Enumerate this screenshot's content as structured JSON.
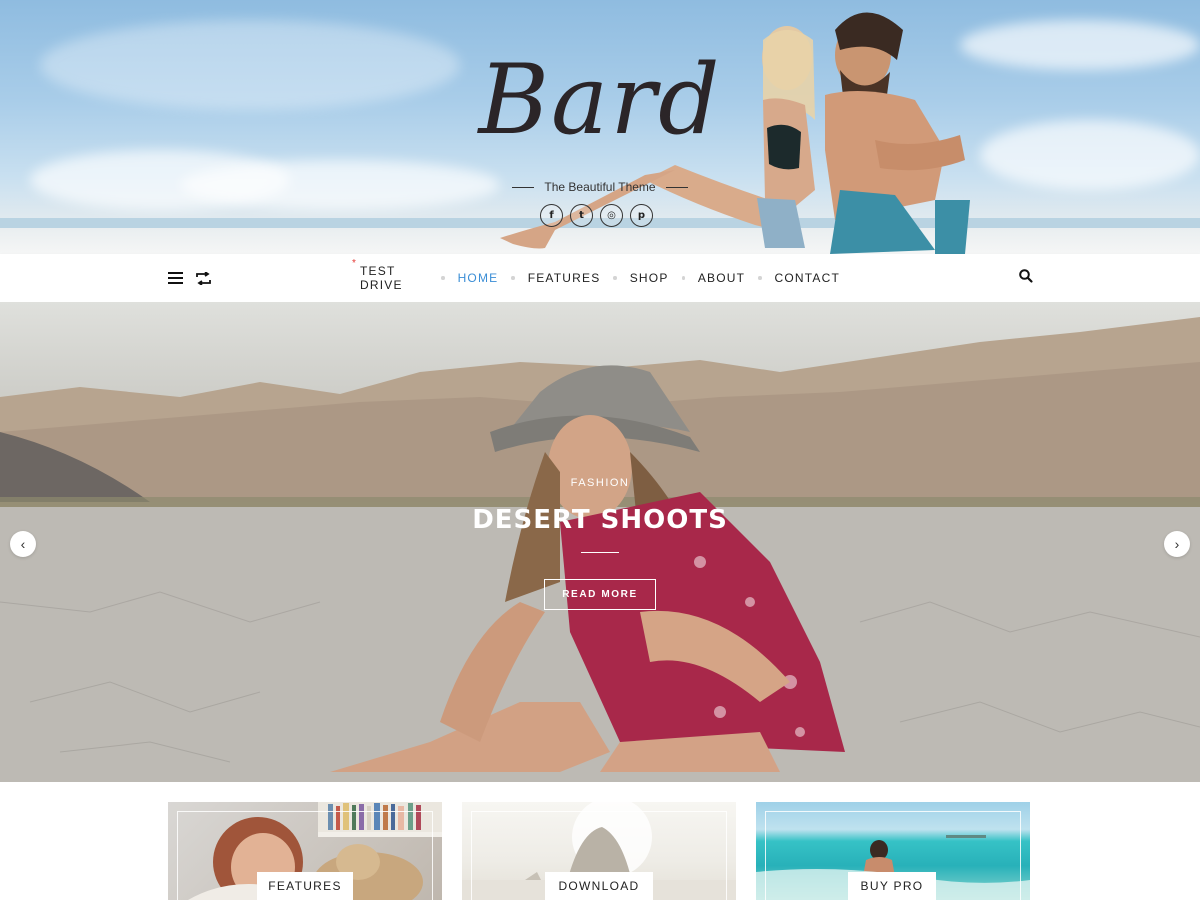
{
  "header": {
    "logo": "Bard",
    "tagline": "The Beautiful Theme",
    "social": [
      {
        "icon": "facebook-icon",
        "glyph": "f"
      },
      {
        "icon": "twitter-icon",
        "glyph": "t"
      },
      {
        "icon": "instagram-icon",
        "glyph": "◎"
      },
      {
        "icon": "pinterest-icon",
        "glyph": "p"
      }
    ]
  },
  "nav": {
    "items": [
      {
        "label": "TEST DRIVE",
        "active": false,
        "new": true
      },
      {
        "label": "HOME",
        "active": true,
        "new": false
      },
      {
        "label": "FEATURES",
        "active": false,
        "new": false
      },
      {
        "label": "SHOP",
        "active": false,
        "new": false
      },
      {
        "label": "ABOUT",
        "active": false,
        "new": false
      },
      {
        "label": "CONTACT",
        "active": false,
        "new": false
      }
    ],
    "new_marker": "*",
    "active_color": "#3b8ed6"
  },
  "slider": {
    "category": "FASHION",
    "title": "DESERT SHOOTS",
    "button": "READ MORE",
    "prev_glyph": "‹",
    "next_glyph": "›"
  },
  "promos": [
    {
      "label": "FEATURES"
    },
    {
      "label": "DOWNLOAD"
    },
    {
      "label": "BUY PRO"
    }
  ]
}
